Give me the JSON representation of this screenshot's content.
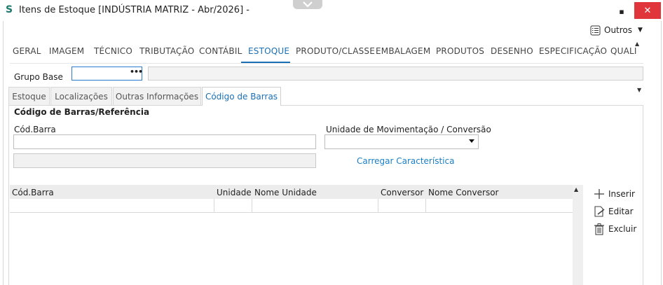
{
  "window": {
    "title": "Itens de Estoque [INDÚSTRIA MATRIZ - Abr/2026]  -",
    "app_icon": "S",
    "minimize_glyph": "▪",
    "close_glyph": "✕"
  },
  "toolbar": {
    "outros_label": "Outros",
    "outros_caret": "▼"
  },
  "main_tabs": [
    {
      "label": "GERAL"
    },
    {
      "label": "IMAGEM"
    },
    {
      "label": "TÉCNICO"
    },
    {
      "label": "TRIBUTAÇÃO"
    },
    {
      "label": "CONTÁBIL"
    },
    {
      "label": "ESTOQUE",
      "active": true
    },
    {
      "label": "PRODUTO/CLASSE"
    },
    {
      "label": "EMBALAGEM"
    },
    {
      "label": "PRODUTOS"
    },
    {
      "label": "DESENHO"
    },
    {
      "label": "ESPECIFICAÇÃO"
    },
    {
      "label": "QUALI"
    }
  ],
  "grupo_base": {
    "label": "Grupo Base",
    "value": "",
    "lookup": "•••",
    "description": ""
  },
  "sub_tabs": [
    {
      "label": "Estoque"
    },
    {
      "label": "Localizações"
    },
    {
      "label": "Outras Informações"
    },
    {
      "label": "Código de Barras",
      "active": true
    }
  ],
  "barcode_section": {
    "title": "Código de Barras/Referência",
    "cod_barra_label": "Cód.Barra",
    "cod_barra_value": "",
    "cod_barra_secondary": "",
    "unidade_label": "Unidade de Movimentação / Conversão",
    "unidade_value": "",
    "carregar_link": "Carregar Característica"
  },
  "grid": {
    "columns": [
      "Cód.Barra",
      "Unidade",
      "Nome Unidade",
      "Conversor",
      "Nome Conversor"
    ],
    "rows": []
  },
  "actions": {
    "insert": "Inserir",
    "edit": "Editar",
    "delete": "Excluir"
  },
  "colors": {
    "accent": "#1a6fb4",
    "link": "#1a7fc4",
    "close": "#e0353a",
    "brand_icon": "#1a7a6e"
  }
}
